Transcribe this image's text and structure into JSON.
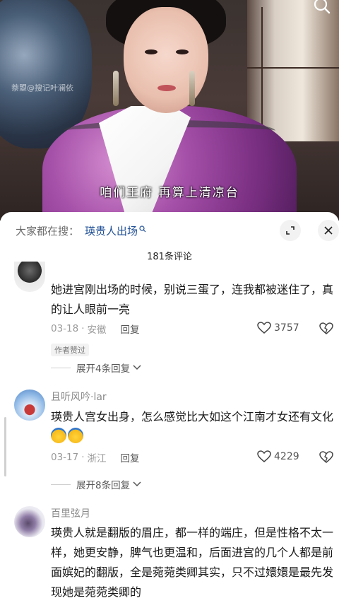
{
  "video": {
    "watermark": "萘曌@搜记叶澜依",
    "subtitle": "咱们王府   再算上清凉台"
  },
  "sheet": {
    "search_prefix": "大家都在搜：",
    "search_term": "瑛贵人出场",
    "comment_count": "181条评论"
  },
  "comments": [
    {
      "username": "",
      "text": "她进宫刚出场的时候，别说三蛋了，连我都被迷住了，真的让人眼前一亮",
      "date": "03-18",
      "location": "安徽",
      "reply_label": "回复",
      "likes": "3757",
      "badge": "作者赞过",
      "expand_label": "展开4条回复"
    },
    {
      "username": "且听风吟·lar",
      "text": "瑛贵人宫女出身，怎么感觉比大如这个江南才女还有文化",
      "date": "03-17",
      "location": "浙江",
      "reply_label": "回复",
      "likes": "4229",
      "expand_label": "展开8条回复"
    },
    {
      "username": "百里弦月",
      "text": "瑛贵人就是翻版的眉庄，都一样的端庄，但是性格不太一样，她更安静，脾气也更温和，后面进宫的几个人都是前面嫔妃的翻版，全是菀菀类卿其实，只不过嬛嬛是最先发现她是菀菀类卿的"
    }
  ]
}
